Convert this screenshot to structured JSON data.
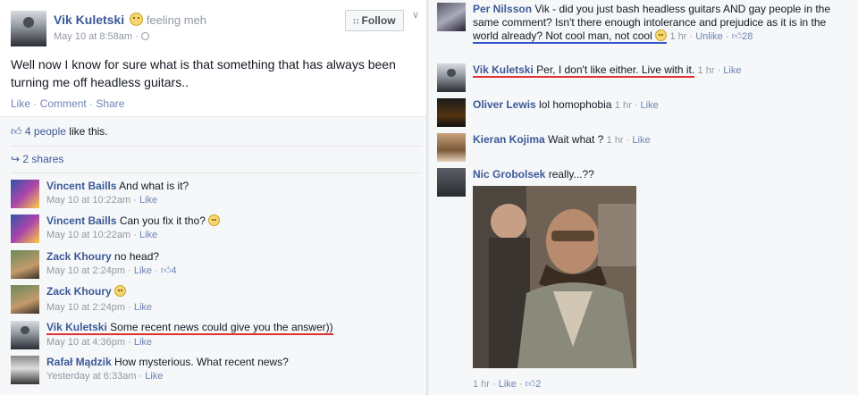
{
  "post": {
    "author": "Vik Kuletski",
    "feeling": "feeling meh",
    "timestamp": "May 10 at 8:58am",
    "follow_label": "Follow",
    "text": "Well now I know for sure what is that something that has always been turning me off headless guitars..",
    "actions": {
      "like": "Like",
      "comment": "Comment",
      "share": "Share",
      "sep": "·"
    },
    "likes_count": "4 people",
    "likes_suffix": "like this.",
    "shares": "2 shares"
  },
  "left_comments": [
    {
      "name": "Vincent Baills",
      "text": "And what is it?",
      "time": "May 10 at 10:22am",
      "like": "Like"
    },
    {
      "name": "Vincent Baills",
      "text": "Can you fix it tho?",
      "time": "May 10 at 10:22am",
      "like": "Like"
    },
    {
      "name": "Zack Khoury",
      "text": "no head?",
      "time": "May 10 at 2:24pm",
      "like": "Like",
      "likes": "4"
    },
    {
      "name": "Zack Khoury",
      "text": "",
      "time": "May 10 at 2:24pm",
      "like": "Like"
    },
    {
      "name": "Vik Kuletski",
      "text": "Some recent news could give you the answer))",
      "time": "May 10 at 4:36pm",
      "like": "Like"
    },
    {
      "name": "Rafał Mądzik",
      "text": "How mysterious. What recent news?",
      "time": "Yesterday at 6:33am",
      "like": "Like"
    }
  ],
  "right_comments": [
    {
      "name": "Per Nilsson",
      "text_a": "Vik - did you just bash headless guitars AND gay people in the same comment? Isn't there enough intolerance and prejudice as it is in the",
      "text_b": "world already? Not cool man, not cool",
      "time": "1 hr",
      "like": "Unlike",
      "likes": "28"
    },
    {
      "name": "Vik Kuletski",
      "text": "Per, I don't like either. Live with it.",
      "time": "1 hr",
      "like": "Like"
    },
    {
      "name": "Oliver Lewis",
      "text": "lol homophobia",
      "time": "1 hr",
      "like": "Like"
    },
    {
      "name": "Kieran Kojima",
      "text": "Wait what ?",
      "time": "1 hr",
      "like": "Like"
    },
    {
      "name": "Nic Grobolsek",
      "text": "really...??",
      "time": "1 hr",
      "like": "Like",
      "likes": "2"
    }
  ],
  "icons": {
    "follow": "rss-icon",
    "likes": "thumbs-up-icon",
    "shares": "share-arrow-icon",
    "privacy": "globe-icon",
    "menu": "chevron-down-icon"
  },
  "colors": {
    "link": "#3b5998",
    "meta": "#9197a3",
    "underline_red": "#e03030",
    "underline_blue": "#3355cc"
  }
}
